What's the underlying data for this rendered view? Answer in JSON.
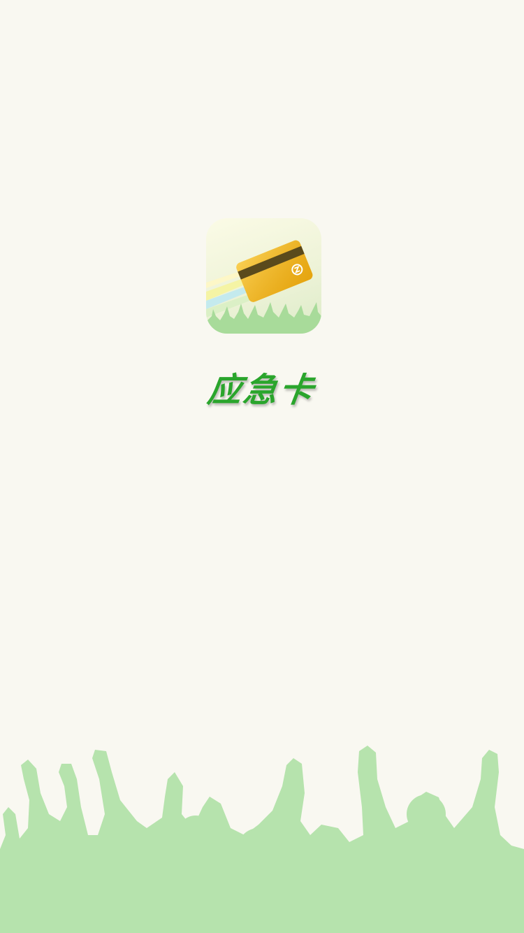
{
  "app": {
    "title": "应急卡"
  },
  "icons": {
    "app_icon": "card-icon",
    "background": "crowd-silhouette"
  },
  "colors": {
    "background": "#f9f8f1",
    "accent": "#2aa52c",
    "crowd": "#b6e3ad",
    "card": "#f2b418"
  }
}
